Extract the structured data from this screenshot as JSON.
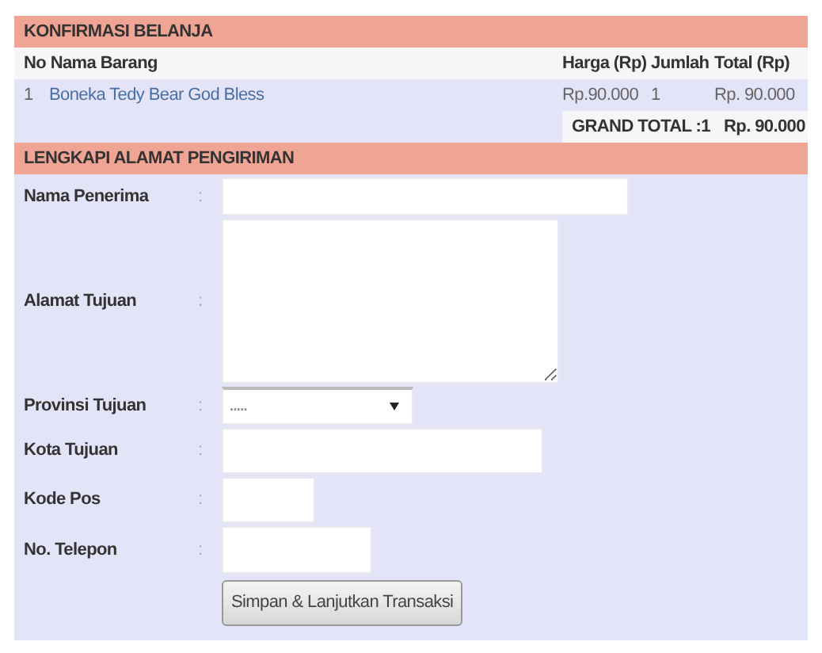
{
  "cart": {
    "title": "KONFIRMASI BELANJA",
    "columns": {
      "no_name": "No Nama Barang",
      "price": "Harga (Rp)",
      "qty": "Jumlah",
      "total": "Total (Rp)"
    },
    "rows": [
      {
        "no": "1",
        "name": "Boneka Tedy Bear God Bless",
        "price": "Rp.90.000",
        "qty": "1",
        "total": "Rp. 90.000"
      }
    ],
    "grand_total": {
      "label": "GRAND TOTAL :1",
      "value": "Rp. 90.000"
    }
  },
  "shipping": {
    "title": "LENGKAPI ALAMAT PENGIRIMAN",
    "fields": [
      {
        "label": "Nama Penerima",
        "kind": "text"
      },
      {
        "label": "Alamat Tujuan",
        "kind": "textarea"
      },
      {
        "label": "Provinsi Tujuan",
        "kind": "select",
        "value": "....."
      },
      {
        "label": "Kota Tujuan",
        "kind": "text"
      },
      {
        "label": "Kode Pos",
        "kind": "text"
      },
      {
        "label": "No. Telepon",
        "kind": "text"
      }
    ],
    "separator": ":",
    "submit": "Simpan & Lanjutkan Transaksi"
  }
}
